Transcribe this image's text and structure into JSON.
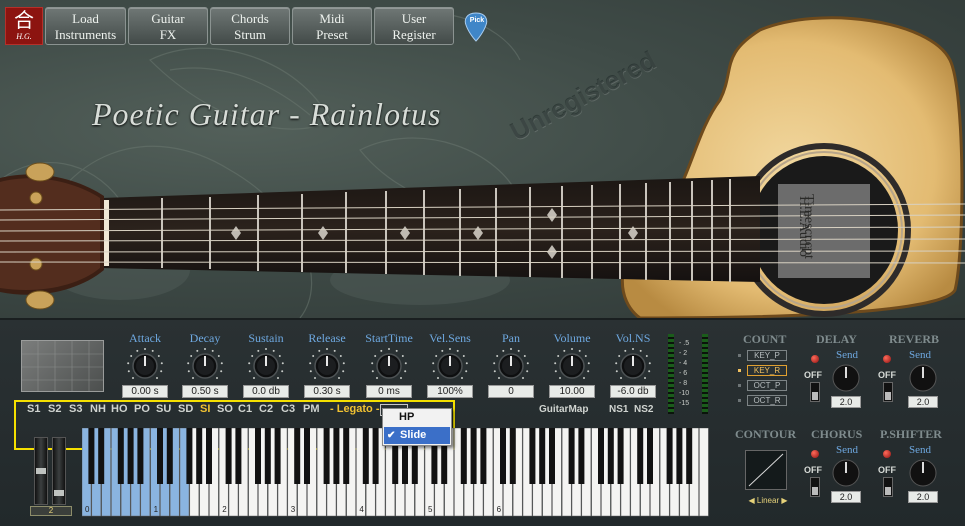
{
  "logo": {
    "glyph": "合",
    "text": "H.G."
  },
  "toolbar": [
    {
      "line1": "Load",
      "line2": "Instruments"
    },
    {
      "line1": "Guitar",
      "line2": "FX"
    },
    {
      "line1": "Chords",
      "line2": "Strum"
    },
    {
      "line1": "Midi",
      "line2": "Preset"
    },
    {
      "line1": "User",
      "line2": "Register"
    }
  ],
  "pick_label": "Pick",
  "title": "Poetic Guitar - Rainlotus",
  "watermark": "Unregistered",
  "soundhole": {
    "line1": "H.E.Audio",
    "line2": "Timescncpt"
  },
  "knobs": [
    {
      "label": "Attack",
      "value": "0.00 s"
    },
    {
      "label": "Decay",
      "value": "0.50 s"
    },
    {
      "label": "Sustain",
      "value": "0.0 db"
    },
    {
      "label": "Release",
      "value": "0.30 s"
    },
    {
      "label": "StartTime",
      "value": "0 ms"
    },
    {
      "label": "Vel.Sens",
      "value": "100%"
    },
    {
      "label": "Pan",
      "value": "0"
    },
    {
      "label": "Volume",
      "value": "10.00"
    },
    {
      "label": "Vol.NS",
      "value": "-6.0 db"
    }
  ],
  "meter_labels": [
    "- .5",
    "- 2",
    "- 4",
    "- 6",
    "- 8",
    "-10",
    "-15"
  ],
  "articulations": [
    "S1",
    "S2",
    "S3",
    "NH",
    "HO",
    "PO",
    "SU",
    "SD",
    "SI",
    "SO",
    "C1",
    "C2",
    "C3",
    "PM"
  ],
  "active_articulation": "SI",
  "legato_label": "- Legato -",
  "guitarmap_label": "GuitarMap",
  "ns_buttons": [
    "NS1",
    "NS2"
  ],
  "dropdown": {
    "options": [
      "HP",
      "Slide"
    ],
    "selected": "Slide",
    "check": "✔"
  },
  "octave_selector": "2",
  "keyboard": {
    "octave_labels": [
      "0",
      "1",
      "2",
      "3",
      "4",
      "5",
      "6"
    ],
    "highlight_color": "#8ab4e0"
  },
  "rack": {
    "count": {
      "title": "COUNT",
      "options": [
        "KEY_P",
        "KEY_R",
        "OCT_P",
        "OCT_R"
      ],
      "selected": "KEY_R"
    },
    "delay": {
      "title": "DELAY",
      "send_label": "Send",
      "off_label": "OFF",
      "send_value": "2.0"
    },
    "reverb": {
      "title": "REVERB",
      "send_label": "Send",
      "off_label": "OFF",
      "send_value": "2.0"
    },
    "contour": {
      "title": "CONTOUR",
      "mode": "Linear"
    },
    "chorus": {
      "title": "CHORUS",
      "send_label": "Send",
      "off_label": "OFF",
      "send_value": "2.0"
    },
    "pshifter": {
      "title": "P.SHIFTER",
      "send_label": "Send",
      "off_label": "OFF",
      "send_value": "2.0"
    }
  },
  "colors": {
    "accent_blue": "#6ea8e0",
    "accent_yellow": "#f1c232",
    "highlight_frame": "#f5e000"
  }
}
